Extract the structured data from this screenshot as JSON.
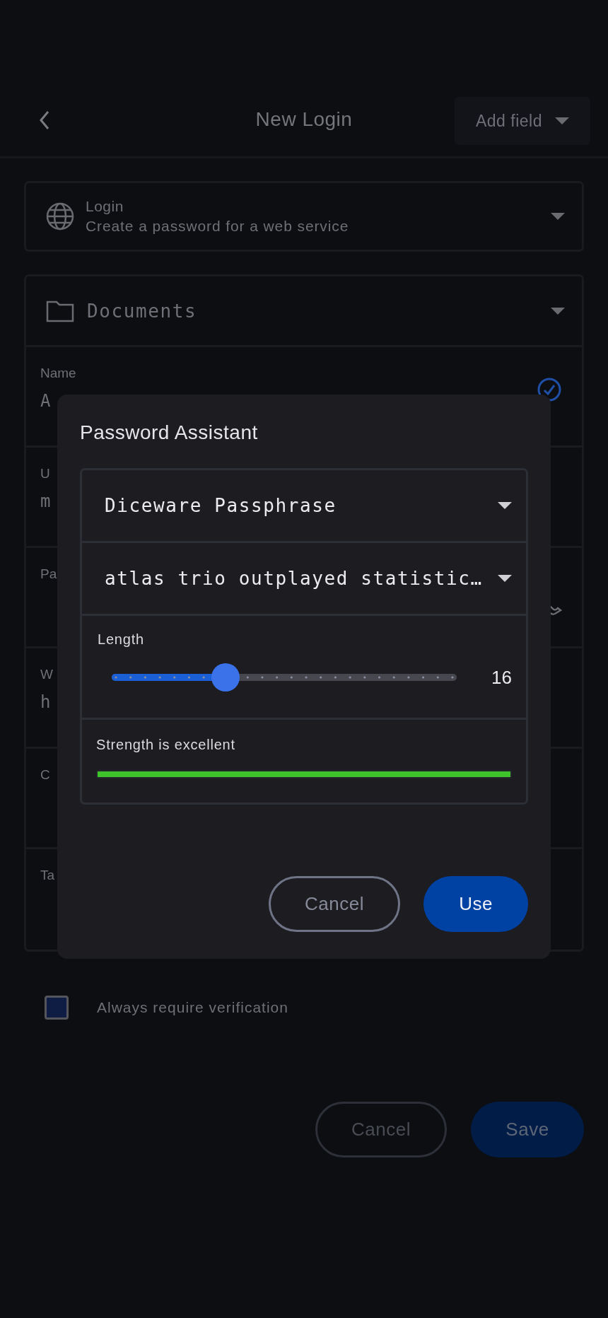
{
  "header": {
    "title": "New Login",
    "add_field": "Add field"
  },
  "type_card": {
    "title": "Login",
    "subtitle": "Create a password for a web service"
  },
  "vault": {
    "name": "Documents"
  },
  "fields": [
    {
      "kind": "verified",
      "label": "Name",
      "value": "A"
    },
    {
      "kind": "text",
      "label": "U",
      "value": "m"
    },
    {
      "kind": "password",
      "label": "Pa"
    },
    {
      "kind": "text",
      "label": "W",
      "value": "h"
    },
    {
      "kind": "text",
      "label": "C"
    },
    {
      "kind": "text",
      "label": "Ta"
    }
  ],
  "dialog": {
    "title": "Password Assistant",
    "generator": "Diceware Passphrase",
    "password": "atlas trio outplayed statistic…",
    "length": {
      "label": "Length",
      "level": 0.33,
      "reading": "16"
    },
    "strength": {
      "label": "Strength is excellent",
      "level": 1,
      "color": "#3ec42a"
    },
    "buttons": [
      {
        "label": "Cancel",
        "kind": "secondary"
      },
      {
        "label": "Use",
        "kind": "primary"
      }
    ]
  },
  "verification": {
    "label": "Always require verification",
    "checked": false
  },
  "buttons": [
    {
      "label": "Cancel",
      "kind": "secondary"
    },
    {
      "label": "Save",
      "kind": "primary"
    }
  ]
}
